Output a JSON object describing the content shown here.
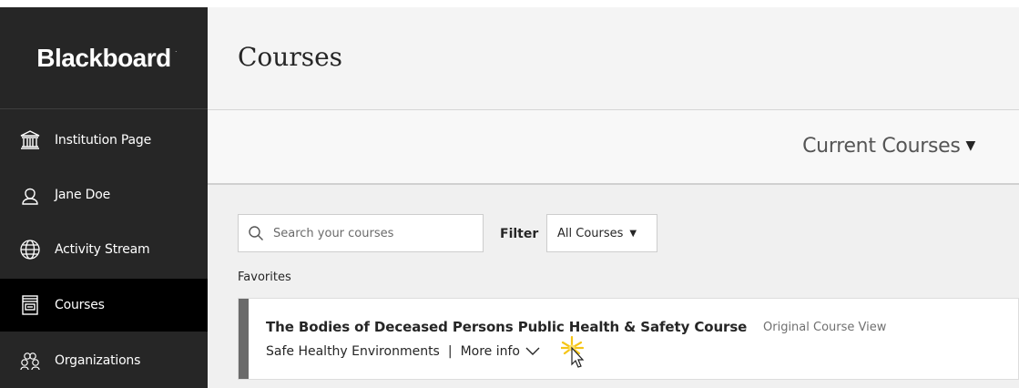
{
  "brand": {
    "logo_text": "Blackboard",
    "mark": "."
  },
  "sidebar": {
    "items": [
      {
        "label": "Institution Page",
        "icon": "institution-icon"
      },
      {
        "label": "Jane Doe",
        "icon": "user-icon"
      },
      {
        "label": "Activity Stream",
        "icon": "globe-icon"
      },
      {
        "label": "Courses",
        "icon": "courses-icon",
        "active": true
      },
      {
        "label": "Organizations",
        "icon": "organizations-icon"
      }
    ]
  },
  "header": {
    "title": "Courses"
  },
  "courses_filter": {
    "current_label": "Current Courses",
    "caret": "▼"
  },
  "search": {
    "placeholder": "Search your courses"
  },
  "filter": {
    "label": "Filter",
    "selected": "All Courses",
    "caret": "▼"
  },
  "favorites": {
    "label": "Favorites"
  },
  "course": {
    "title": "The Bodies of Deceased Persons Public Health & Safety Course",
    "view": "Original Course View",
    "instructor": "Safe Healthy Environments",
    "separator": "|",
    "more_info": "More info"
  },
  "colors": {
    "sidebar_bg": "#262626",
    "active_bg": "#000000",
    "accent_stripe": "#6a6a6a",
    "cursor_glow": "#f5c518"
  }
}
